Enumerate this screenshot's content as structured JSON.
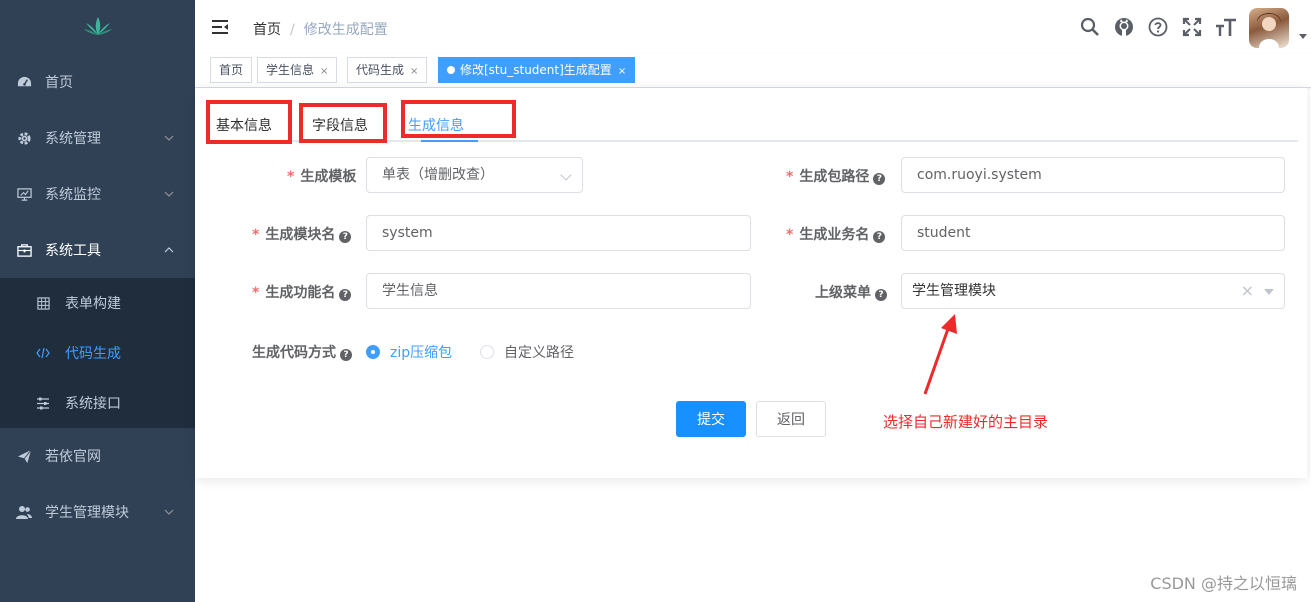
{
  "sidebar": {
    "items": [
      {
        "label": "首页",
        "icon": "dashboard-icon"
      },
      {
        "label": "系统管理",
        "icon": "gear-icon"
      },
      {
        "label": "系统监控",
        "icon": "monitor-icon"
      },
      {
        "label": "系统工具",
        "icon": "toolbox-icon"
      }
    ],
    "submenu": [
      {
        "label": "表单构建",
        "icon": "grid-icon"
      },
      {
        "label": "代码生成",
        "icon": "code-icon"
      },
      {
        "label": "系统接口",
        "icon": "sliders-icon"
      }
    ],
    "items_after": [
      {
        "label": "若依官网",
        "icon": "paper-plane-icon"
      },
      {
        "label": "学生管理模块",
        "icon": "users-icon"
      }
    ]
  },
  "breadcrumb": {
    "home": "首页",
    "separator": "/",
    "current": "修改生成配置"
  },
  "tags": [
    {
      "label": "首页"
    },
    {
      "label": "学生信息",
      "close": "×"
    },
    {
      "label": "代码生成",
      "close": "×"
    },
    {
      "label": "修改[stu_student]生成配置",
      "close": "×"
    }
  ],
  "tabs": [
    {
      "label": "基本信息"
    },
    {
      "label": "字段信息"
    },
    {
      "label": "生成信息"
    }
  ],
  "form": {
    "tpl_label": "生成模板",
    "tpl_value": "单表（增删改查）",
    "pkg_label": "生成包路径",
    "pkg_value": "com.ruoyi.system",
    "module_label": "生成模块名",
    "module_value": "system",
    "business_label": "生成业务名",
    "business_value": "student",
    "func_label": "生成功能名",
    "func_value": "学生信息",
    "parent_label": "上级菜单",
    "parent_value": "学生管理模块",
    "parent_clear": "×",
    "gen_label": "生成代码方式",
    "radio_zip": "zip压缩包",
    "radio_custom": "自定义路径",
    "required_mark": "*",
    "help_mark": "?"
  },
  "buttons": {
    "submit": "提交",
    "back": "返回"
  },
  "annotation": "选择自己新建好的主目录",
  "watermark": "CSDN @持之以恒璃",
  "colors": {
    "sidebar": "#304156",
    "accent": "#409eff",
    "annotation": "#ee2a2a"
  }
}
